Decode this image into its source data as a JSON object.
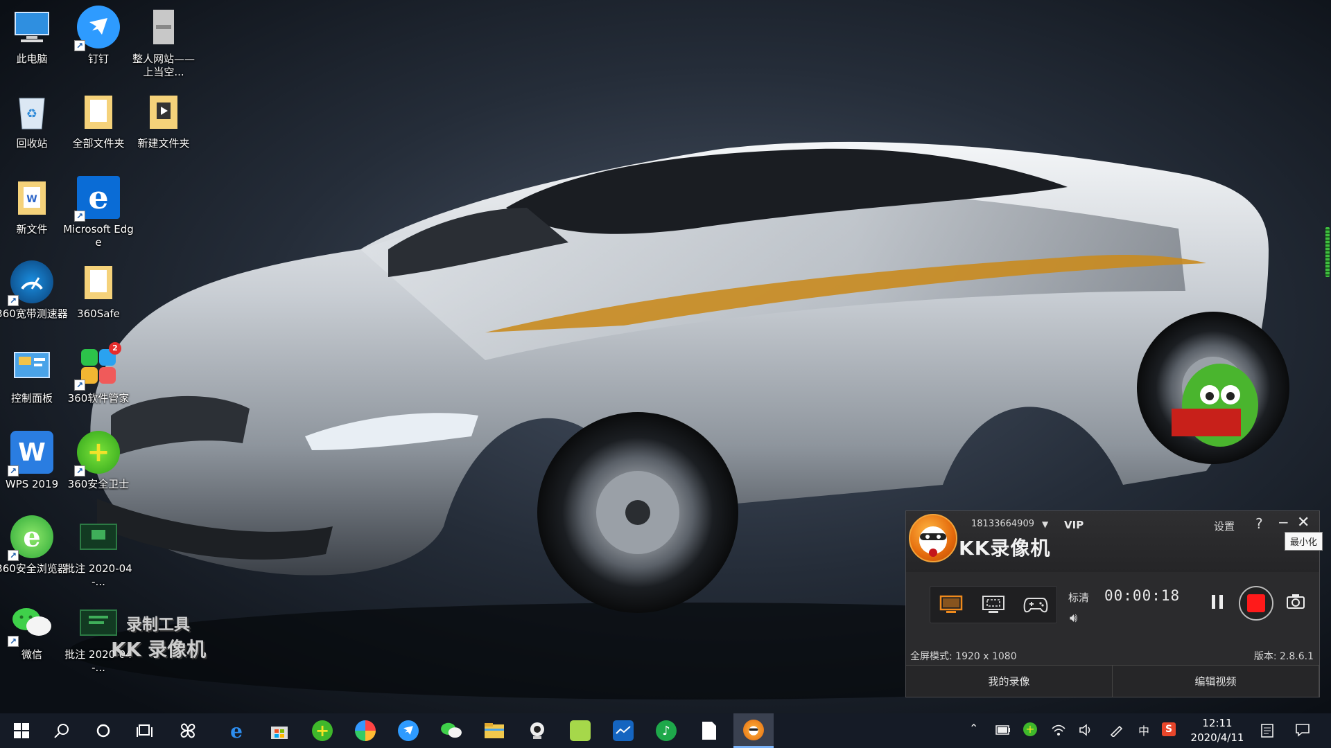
{
  "desktop": {
    "icons": [
      {
        "label": "此电脑",
        "icon": "computer-icon"
      },
      {
        "label": "钉钉",
        "icon": "dingtalk-icon"
      },
      {
        "label": "整人网站——上当空...",
        "icon": "file-icon"
      },
      {
        "label": "回收站",
        "icon": "recycle-bin-icon"
      },
      {
        "label": "全部文件夹",
        "icon": "folder-icon"
      },
      {
        "label": "新建文件夹",
        "icon": "folder-icon"
      },
      {
        "label": "新文件",
        "icon": "folder-icon"
      },
      {
        "label": "Microsoft Edge",
        "icon": "edge-icon"
      },
      {
        "label": "360宽带测速器",
        "icon": "speed-test-icon"
      },
      {
        "label": "360Safe",
        "icon": "folder-icon"
      },
      {
        "label": "控制面板",
        "icon": "control-panel-icon"
      },
      {
        "label": "360软件管家",
        "icon": "software-manager-icon"
      },
      {
        "label": "WPS 2019",
        "icon": "wps-icon"
      },
      {
        "label": "360安全卫士",
        "icon": "360-safe-icon"
      },
      {
        "label": "360安全浏览器",
        "icon": "360-browser-icon"
      },
      {
        "label": "批注 2020-04-...",
        "icon": "image-file-icon"
      },
      {
        "label": "微信",
        "icon": "wechat-icon"
      },
      {
        "label": "批注 2020-04-...",
        "icon": "image-file-icon"
      }
    ],
    "badge_count": "2"
  },
  "watermark": {
    "line1": "录制工具",
    "line2": "KK 录像机"
  },
  "kk": {
    "account": "18133664909",
    "vip": "VIP",
    "title": "KK录像机",
    "settings": "设置",
    "help": "?",
    "minimize": "−",
    "close": "✕",
    "tooltip": "最小化",
    "quality": "标清",
    "timer": "00:00:18",
    "status": "全屏模式: 1920 x 1080",
    "version": "版本: 2.8.6.1",
    "my_recordings": "我的录像",
    "edit_video": "编辑视频"
  },
  "taskbar": {
    "clock_time": "12:11",
    "clock_date": "2020/4/11",
    "ime": "中",
    "tray_badge": "S"
  },
  "colors": {
    "kk_accent": "#e46a0c",
    "record_red": "#ff1a1a",
    "taskbar_bg": "#151b26"
  }
}
